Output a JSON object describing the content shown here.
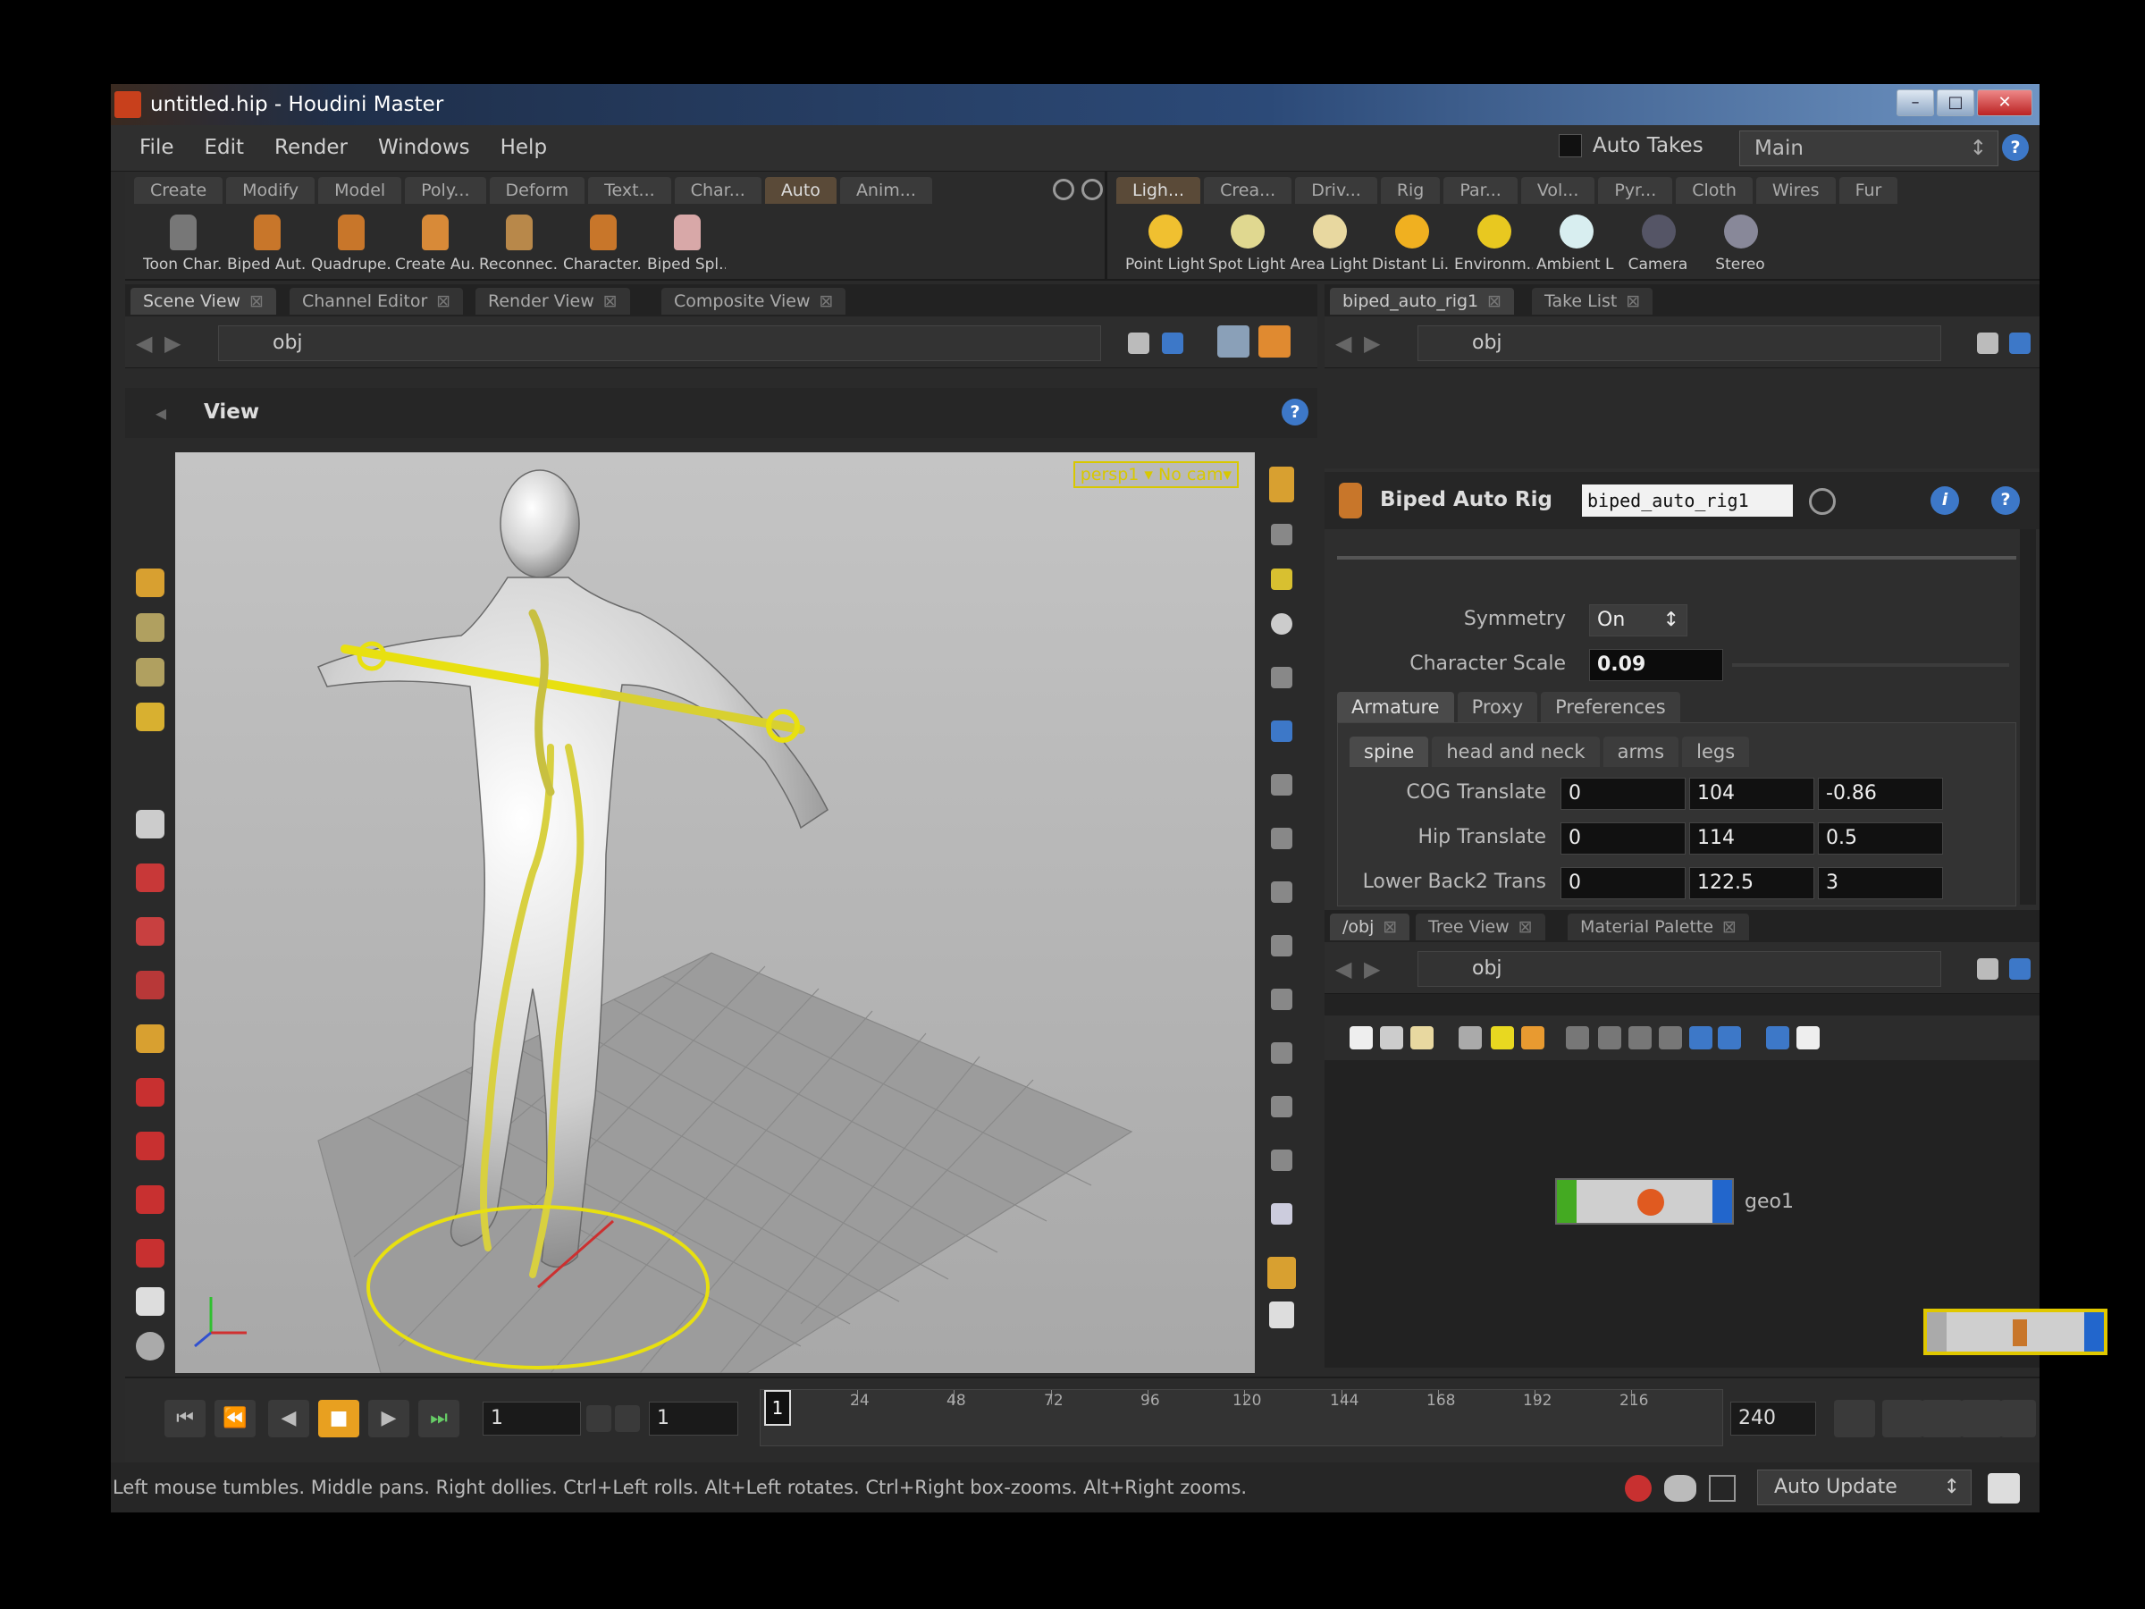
{
  "window": {
    "title": "untitled.hip - Houdini Master"
  },
  "menu": {
    "items": [
      "File",
      "Edit",
      "Render",
      "Windows",
      "Help"
    ]
  },
  "takes": {
    "label": "Auto Takes",
    "selected": "Main"
  },
  "shelf_left": {
    "tabs": [
      "Create",
      "Modify",
      "Model",
      "Poly...",
      "Deform",
      "Text...",
      "Char...",
      "Auto",
      "Anim..."
    ],
    "tools": [
      "Toon Char...",
      "Biped Aut...",
      "Quadrupe...",
      "Create Au...",
      "Reconnec...",
      "Character...",
      "Biped Spl..."
    ]
  },
  "shelf_right": {
    "tabs": [
      "Ligh...",
      "Crea...",
      "Driv...",
      "Rig",
      "Par...",
      "Vol...",
      "Pyr...",
      "Cloth",
      "Wires",
      "Fur"
    ],
    "tools": [
      "Point Light",
      "Spot Light",
      "Area Light",
      "Distant Li...",
      "Environm...",
      "Ambient L...",
      "Camera",
      "Stereo"
    ]
  },
  "viewer_tabs": [
    "Scene View",
    "Channel Editor",
    "Render View",
    "Composite View"
  ],
  "viewer": {
    "path": "obj",
    "title": "View",
    "camera_label": "persp1 ▾  No cam▾"
  },
  "parm_tabs": [
    "biped_auto_rig1",
    "Take List"
  ],
  "parm": {
    "path": "obj",
    "node_type": "Biped Auto Rig",
    "node_name": "biped_auto_rig1",
    "symmetry_label": "Symmetry",
    "symmetry_value": "On",
    "scale_label": "Character Scale",
    "scale_value": "0.09",
    "main_tabs": [
      "Armature",
      "Proxy",
      "Preferences"
    ],
    "sub_tabs": [
      "spine",
      "head and neck",
      "arms",
      "legs"
    ],
    "rows": [
      {
        "label": "COG Translate",
        "v": [
          "0",
          "104",
          "-0.86"
        ]
      },
      {
        "label": "Hip Translate",
        "v": [
          "0",
          "114",
          "0.5"
        ]
      },
      {
        "label": "Lower Back2 Trans",
        "v": [
          "0",
          "122.5",
          "3"
        ]
      }
    ]
  },
  "net_tabs": [
    "/obj",
    "Tree View",
    "Material Palette"
  ],
  "network": {
    "path": "obj",
    "node1": "geo1"
  },
  "playbar": {
    "frame": "1",
    "start": "1",
    "end": "240",
    "current": "1",
    "ticks": [
      "24",
      "48",
      "72",
      "96",
      "120",
      "144",
      "168",
      "192",
      "216"
    ]
  },
  "status": {
    "text": "Left mouse tumbles. Middle pans. Right dollies. Ctrl+Left rolls. Alt+Left rotates. Ctrl+Right box-zooms. Alt+Right zooms.",
    "update_mode": "Auto Update"
  }
}
